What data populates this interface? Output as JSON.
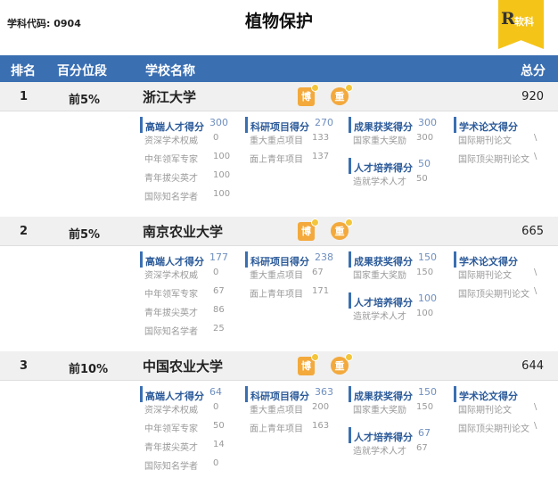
{
  "page": {
    "code_text": "学科代码: 0904",
    "title": "植物保护",
    "logo_letter": "R",
    "logo_text": "软科"
  },
  "header": {
    "rank": "排名",
    "percentile": "百分位段",
    "school": "学校名称",
    "total": "总分"
  },
  "badges": {
    "doctoral": "博",
    "key": "重"
  },
  "universities": [
    {
      "rank": "1",
      "percentile": "前5%",
      "name": "浙江大学",
      "total": "920",
      "talent": {
        "label": "高端人才得分",
        "value": "300",
        "items": [
          {
            "label": "资深学术权威",
            "value": "0"
          },
          {
            "label": "中年领军专家",
            "value": "100"
          },
          {
            "label": "青年拔尖英才",
            "value": "100"
          },
          {
            "label": "国际知名学者",
            "value": "100"
          }
        ]
      },
      "research": {
        "label": "科研项目得分",
        "value": "270",
        "items": [
          {
            "label": "重大重点项目",
            "value": "133"
          },
          {
            "label": "面上青年项目",
            "value": "137"
          }
        ]
      },
      "award": {
        "label": "成果获奖得分",
        "value": "300",
        "items": [
          {
            "label": "国家重大奖励",
            "value": "300"
          }
        ]
      },
      "cultivation": {
        "label": "人才培养得分",
        "value": "50",
        "items": [
          {
            "label": "造就学术人才",
            "value": "50"
          }
        ]
      },
      "paper": {
        "label": "学术论文得分",
        "value": "",
        "items": [
          {
            "label": "国际期刊论文",
            "value": "\\"
          },
          {
            "label": "国际顶尖期刊论文",
            "value": "\\"
          }
        ]
      }
    },
    {
      "rank": "2",
      "percentile": "前5%",
      "name": "南京农业大学",
      "total": "665",
      "talent": {
        "label": "高端人才得分",
        "value": "177",
        "items": [
          {
            "label": "资深学术权威",
            "value": "0"
          },
          {
            "label": "中年领军专家",
            "value": "67"
          },
          {
            "label": "青年拔尖英才",
            "value": "86"
          },
          {
            "label": "国际知名学者",
            "value": "25"
          }
        ]
      },
      "research": {
        "label": "科研项目得分",
        "value": "238",
        "items": [
          {
            "label": "重大重点项目",
            "value": "67"
          },
          {
            "label": "面上青年项目",
            "value": "171"
          }
        ]
      },
      "award": {
        "label": "成果获奖得分",
        "value": "150",
        "items": [
          {
            "label": "国家重大奖励",
            "value": "150"
          }
        ]
      },
      "cultivation": {
        "label": "人才培养得分",
        "value": "100",
        "items": [
          {
            "label": "造就学术人才",
            "value": "100"
          }
        ]
      },
      "paper": {
        "label": "学术论文得分",
        "value": "",
        "items": [
          {
            "label": "国际期刊论文",
            "value": "\\"
          },
          {
            "label": "国际顶尖期刊论文",
            "value": "\\"
          }
        ]
      }
    },
    {
      "rank": "3",
      "percentile": "前10%",
      "name": "中国农业大学",
      "total": "644",
      "talent": {
        "label": "高端人才得分",
        "value": "64",
        "items": [
          {
            "label": "资深学术权威",
            "value": "0"
          },
          {
            "label": "中年领军专家",
            "value": "50"
          },
          {
            "label": "青年拔尖英才",
            "value": "14"
          },
          {
            "label": "国际知名学者",
            "value": "0"
          }
        ]
      },
      "research": {
        "label": "科研项目得分",
        "value": "363",
        "items": [
          {
            "label": "重大重点项目",
            "value": "200"
          },
          {
            "label": "面上青年项目",
            "value": "163"
          }
        ]
      },
      "award": {
        "label": "成果获奖得分",
        "value": "150",
        "items": [
          {
            "label": "国家重大奖励",
            "value": "150"
          }
        ]
      },
      "cultivation": {
        "label": "人才培养得分",
        "value": "67",
        "items": [
          {
            "label": "造就学术人才",
            "value": "67"
          }
        ]
      },
      "paper": {
        "label": "学术论文得分",
        "value": "",
        "items": [
          {
            "label": "国际期刊论文",
            "value": "\\"
          },
          {
            "label": "国际顶尖期刊论文",
            "value": "\\"
          }
        ]
      }
    }
  ]
}
